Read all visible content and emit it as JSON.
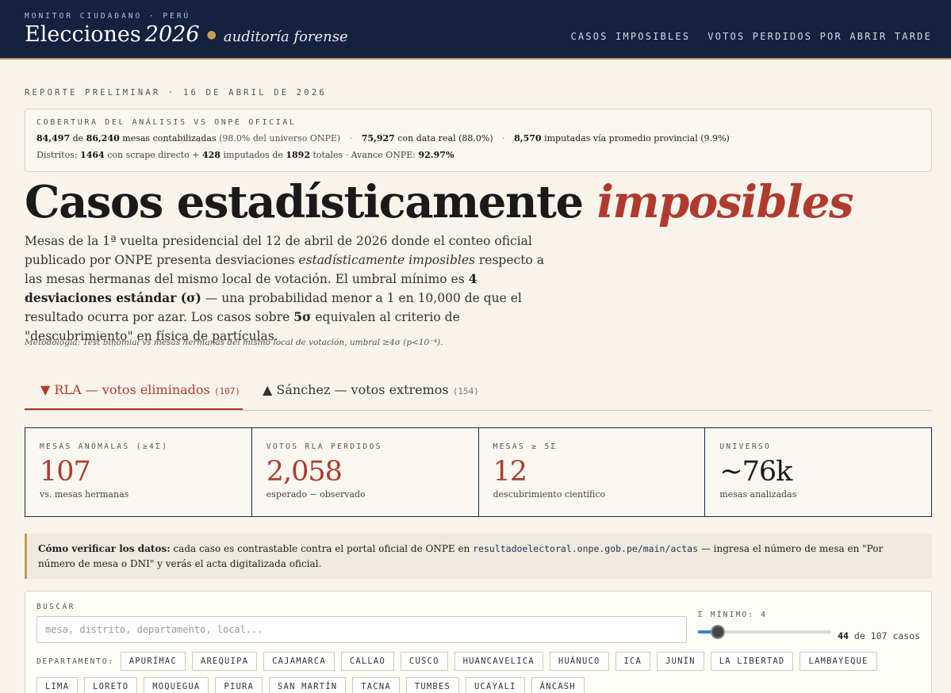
{
  "header": {
    "kicker": "MONITOR CIUDADANO · PERÚ",
    "title_main": "Elecciones",
    "title_year": "2026",
    "title_sub": "auditoría forense",
    "nav": [
      "CASOS IMPOSIBLES",
      "VOTOS PERDIDOS POR ABRIR TARDE"
    ]
  },
  "report_label": "REPORTE PRELIMINAR · 16 DE ABRIL DE 2026",
  "coverage": {
    "heading": "COBERTURA DEL ANÁLISIS VS ONPE OFICIAL",
    "mesas_contab": "84,497",
    "de": "de",
    "mesas_total": "86,240",
    "mesas_text": "mesas contabilizadas",
    "mesas_pct": "(98.0% del universo ONPE)",
    "real": "75,927",
    "real_text": "con data real (88.0%)",
    "imputed": "8,570",
    "imputed_text": "imputadas vía promedio provincial (9.9%)",
    "dist_label": "Distritos:",
    "dist_scrape": "1464",
    "dist_scrape_text": "con scrape directo +",
    "dist_imp": "428",
    "dist_imp_text": "imputados de",
    "dist_total": "1892",
    "dist_total_text": "totales · Avance ONPE:",
    "avance": "92.97%"
  },
  "hero": {
    "title_a": "Casos estadísticamente",
    "title_b": "imposibles"
  },
  "intro": {
    "p1": "Mesas de la 1ª vuelta presidencial del 12 de abril de 2026 donde el conteo oficial publicado por ONPE presenta desviaciones ",
    "p1_em": "estadísticamente imposibles",
    "p2": " respecto a las mesas hermanas del mismo local de votación. El umbral mínimo es ",
    "p2_b": "4 desviaciones estándar (σ)",
    "p3": " — una probabilidad menor a 1 en 10,000 de que el resultado ocurra por azar. Los casos sobre ",
    "p3_b": "5σ",
    "p4": " equivalen al criterio de \"descubrimiento\" en física de partículas."
  },
  "method": "Metodología: Test binomial vs mesas hermanas del mismo local de votación, umbral ≥4σ (p<10⁻⁴).",
  "tabs": [
    {
      "icon": "▼",
      "label": "RLA — votos eliminados",
      "count": "(107)"
    },
    {
      "icon": "▲",
      "label": "Sánchez — votos extremos",
      "count": "(154)"
    }
  ],
  "stats": [
    {
      "label": "MESAS ANÓMALAS (≥4Σ)",
      "value": "107",
      "sub": "vs. mesas hermanas"
    },
    {
      "label": "VOTOS RLA PERDIDOS",
      "value": "2,058",
      "sub": "esperado − observado"
    },
    {
      "label": "MESAS ≥ 5Σ",
      "value": "12",
      "sub": "descubrimiento científico"
    },
    {
      "label": "UNIVERSO",
      "value": "~76k",
      "sub": "mesas analizadas"
    }
  ],
  "verify": {
    "bold": "Cómo verificar los datos:",
    "t1": " cada caso es contrastable contra el portal oficial de ONPE en ",
    "url": "resultadoelectoral.onpe.gob.pe/main/actas",
    "t2": " — ingresa el número de mesa en \"Por número de mesa o DNI\" y verás el acta digitalizada oficial."
  },
  "filter": {
    "search_label": "BUSCAR",
    "search_placeholder": "mesa, distrito, departamento, local...",
    "sigma_label": "Σ MÍNIMO: 4",
    "sigma_value": 4,
    "sigma_min": 4,
    "sigma_max": 10,
    "count_shown": "44",
    "count_text": "de 107 casos",
    "dept_label": "DEPARTAMENTO:",
    "departments": [
      "APURÍMAC",
      "AREQUIPA",
      "CAJAMARCA",
      "CALLAO",
      "CUSCO",
      "HUANCAVELICA",
      "HUÁNUCO",
      "ICA",
      "JUNÍN",
      "LA LIBERTAD",
      "LAMBAYEQUE",
      "LIMA",
      "LORETO",
      "MOQUEGUA",
      "PIURA",
      "SAN MARTÍN",
      "TACNA",
      "TUMBES",
      "UCAYALI",
      "ÁNCASH"
    ]
  },
  "colors": {
    "navy": "#14213f",
    "accent_red": "#b03a2e",
    "gold": "#c99a55",
    "slider_blue": "#3c7ee0"
  }
}
